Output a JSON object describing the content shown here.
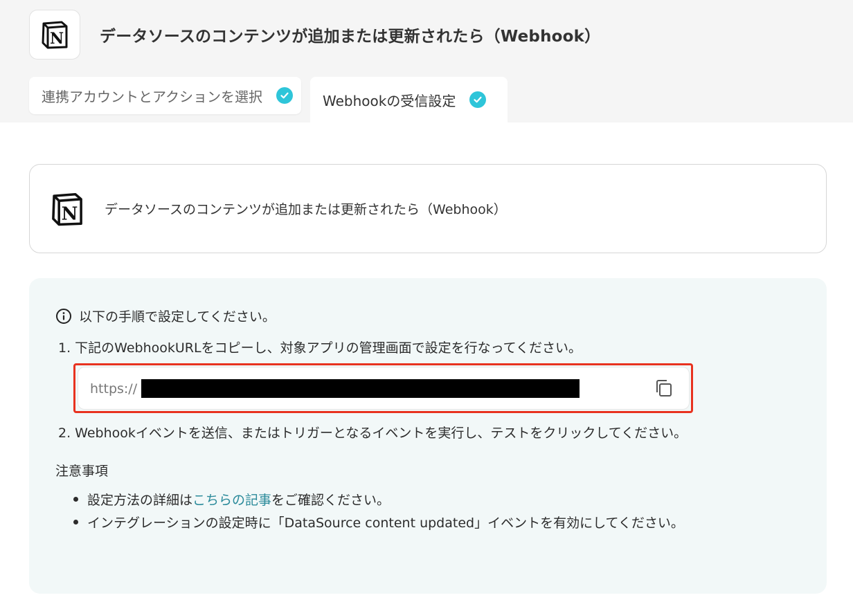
{
  "header": {
    "title": "データソースのコンテンツが追加または更新されたら（Webhook）"
  },
  "tabs": [
    {
      "label": "連携アカウントとアクションを選択",
      "completed": true
    },
    {
      "label": "Webhookの受信設定",
      "completed": true
    }
  ],
  "trigger_card": {
    "title": "データソースのコンテンツが追加または更新されたら（Webhook）"
  },
  "instructions": {
    "heading": "以下の手順で設定してください。",
    "step1": "1. 下記のWebhookURLをコピーし、対象アプリの管理画面で設定を行なってください。",
    "url_prefix": "https://",
    "step2": "2. Webhookイベントを送信、またはトリガーとなるイベントを実行し、テストをクリックしてください。"
  },
  "notes": {
    "title": "注意事項",
    "note1_before": "設定方法の詳細は",
    "note1_link": "こちらの記事",
    "note1_after": "をご確認ください。",
    "note2": "インテグレーションの設定時に「DataSource content updated」イベントを有効にしてください。"
  },
  "colors": {
    "accent_check": "#2ec5d9",
    "highlight_border": "#e8321f",
    "link": "#2a8a9a",
    "panel_bg": "#f2f8f8"
  },
  "icons": {
    "app_logo": "notion-icon",
    "tab_status": "check-circle-icon",
    "info": "info-circle-icon",
    "copy": "copy-icon"
  }
}
